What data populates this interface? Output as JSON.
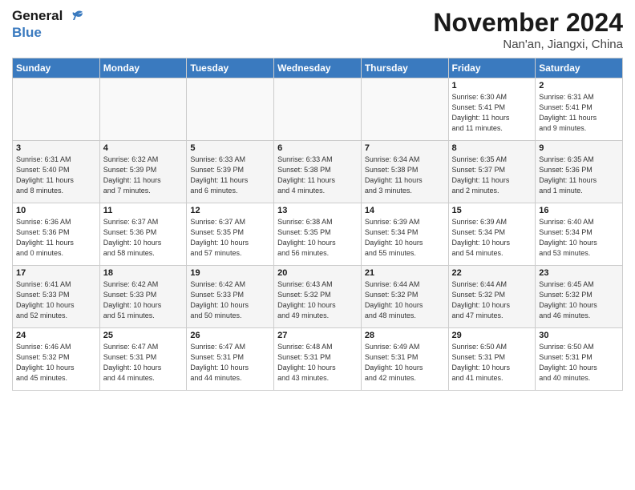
{
  "logo": {
    "line1": "General",
    "line2": "Blue"
  },
  "title": "November 2024",
  "location": "Nan'an, Jiangxi, China",
  "headers": [
    "Sunday",
    "Monday",
    "Tuesday",
    "Wednesday",
    "Thursday",
    "Friday",
    "Saturday"
  ],
  "weeks": [
    [
      {
        "day": "",
        "info": ""
      },
      {
        "day": "",
        "info": ""
      },
      {
        "day": "",
        "info": ""
      },
      {
        "day": "",
        "info": ""
      },
      {
        "day": "",
        "info": ""
      },
      {
        "day": "1",
        "info": "Sunrise: 6:30 AM\nSunset: 5:41 PM\nDaylight: 11 hours\nand 11 minutes."
      },
      {
        "day": "2",
        "info": "Sunrise: 6:31 AM\nSunset: 5:41 PM\nDaylight: 11 hours\nand 9 minutes."
      }
    ],
    [
      {
        "day": "3",
        "info": "Sunrise: 6:31 AM\nSunset: 5:40 PM\nDaylight: 11 hours\nand 8 minutes."
      },
      {
        "day": "4",
        "info": "Sunrise: 6:32 AM\nSunset: 5:39 PM\nDaylight: 11 hours\nand 7 minutes."
      },
      {
        "day": "5",
        "info": "Sunrise: 6:33 AM\nSunset: 5:39 PM\nDaylight: 11 hours\nand 6 minutes."
      },
      {
        "day": "6",
        "info": "Sunrise: 6:33 AM\nSunset: 5:38 PM\nDaylight: 11 hours\nand 4 minutes."
      },
      {
        "day": "7",
        "info": "Sunrise: 6:34 AM\nSunset: 5:38 PM\nDaylight: 11 hours\nand 3 minutes."
      },
      {
        "day": "8",
        "info": "Sunrise: 6:35 AM\nSunset: 5:37 PM\nDaylight: 11 hours\nand 2 minutes."
      },
      {
        "day": "9",
        "info": "Sunrise: 6:35 AM\nSunset: 5:36 PM\nDaylight: 11 hours\nand 1 minute."
      }
    ],
    [
      {
        "day": "10",
        "info": "Sunrise: 6:36 AM\nSunset: 5:36 PM\nDaylight: 11 hours\nand 0 minutes."
      },
      {
        "day": "11",
        "info": "Sunrise: 6:37 AM\nSunset: 5:36 PM\nDaylight: 10 hours\nand 58 minutes."
      },
      {
        "day": "12",
        "info": "Sunrise: 6:37 AM\nSunset: 5:35 PM\nDaylight: 10 hours\nand 57 minutes."
      },
      {
        "day": "13",
        "info": "Sunrise: 6:38 AM\nSunset: 5:35 PM\nDaylight: 10 hours\nand 56 minutes."
      },
      {
        "day": "14",
        "info": "Sunrise: 6:39 AM\nSunset: 5:34 PM\nDaylight: 10 hours\nand 55 minutes."
      },
      {
        "day": "15",
        "info": "Sunrise: 6:39 AM\nSunset: 5:34 PM\nDaylight: 10 hours\nand 54 minutes."
      },
      {
        "day": "16",
        "info": "Sunrise: 6:40 AM\nSunset: 5:34 PM\nDaylight: 10 hours\nand 53 minutes."
      }
    ],
    [
      {
        "day": "17",
        "info": "Sunrise: 6:41 AM\nSunset: 5:33 PM\nDaylight: 10 hours\nand 52 minutes."
      },
      {
        "day": "18",
        "info": "Sunrise: 6:42 AM\nSunset: 5:33 PM\nDaylight: 10 hours\nand 51 minutes."
      },
      {
        "day": "19",
        "info": "Sunrise: 6:42 AM\nSunset: 5:33 PM\nDaylight: 10 hours\nand 50 minutes."
      },
      {
        "day": "20",
        "info": "Sunrise: 6:43 AM\nSunset: 5:32 PM\nDaylight: 10 hours\nand 49 minutes."
      },
      {
        "day": "21",
        "info": "Sunrise: 6:44 AM\nSunset: 5:32 PM\nDaylight: 10 hours\nand 48 minutes."
      },
      {
        "day": "22",
        "info": "Sunrise: 6:44 AM\nSunset: 5:32 PM\nDaylight: 10 hours\nand 47 minutes."
      },
      {
        "day": "23",
        "info": "Sunrise: 6:45 AM\nSunset: 5:32 PM\nDaylight: 10 hours\nand 46 minutes."
      }
    ],
    [
      {
        "day": "24",
        "info": "Sunrise: 6:46 AM\nSunset: 5:32 PM\nDaylight: 10 hours\nand 45 minutes."
      },
      {
        "day": "25",
        "info": "Sunrise: 6:47 AM\nSunset: 5:31 PM\nDaylight: 10 hours\nand 44 minutes."
      },
      {
        "day": "26",
        "info": "Sunrise: 6:47 AM\nSunset: 5:31 PM\nDaylight: 10 hours\nand 44 minutes."
      },
      {
        "day": "27",
        "info": "Sunrise: 6:48 AM\nSunset: 5:31 PM\nDaylight: 10 hours\nand 43 minutes."
      },
      {
        "day": "28",
        "info": "Sunrise: 6:49 AM\nSunset: 5:31 PM\nDaylight: 10 hours\nand 42 minutes."
      },
      {
        "day": "29",
        "info": "Sunrise: 6:50 AM\nSunset: 5:31 PM\nDaylight: 10 hours\nand 41 minutes."
      },
      {
        "day": "30",
        "info": "Sunrise: 6:50 AM\nSunset: 5:31 PM\nDaylight: 10 hours\nand 40 minutes."
      }
    ]
  ]
}
